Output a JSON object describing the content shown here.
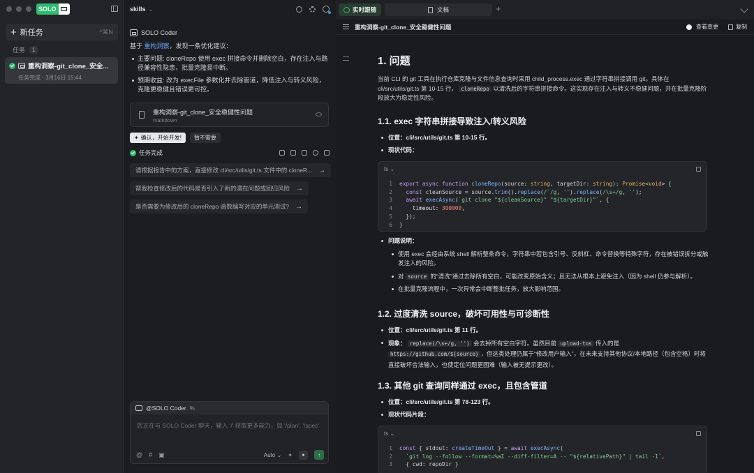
{
  "sidebar": {
    "logo_text": "SOLO",
    "new_task": "新任务",
    "new_task_shortcut": "^⌘N",
    "task_header": "任务",
    "task_count": "1",
    "task_title": "重构洞察-git_clone_安全...",
    "task_meta": "任务完成 · 3月16日 15:44"
  },
  "chat": {
    "workspace": "skills",
    "agent": "SOLO Coder",
    "intro_pre": "基于",
    "intro_link": "重构洞察",
    "intro_post": "，发现一条优化建议：",
    "bullet1": "主要问题: cloneRepo 使用 exec 拼接命令并删除空白，存在注入与路径兼容性隐患，批量克隆易中断。",
    "bullet2": "预期收益: 改为 execFile 参数化并去除管道，降低注入与转义风险，克隆更稳健且错误更可控。",
    "doc_card_title": "重构洞察-git_clone_安全稳健性问题",
    "doc_card_type": "markdown",
    "confirm_btn": "确认，开始开发!",
    "decline_btn": "暂不需要",
    "status": "任务完成",
    "suggestions": [
      "请根据报告中的方案，直接修改 cli/src/utils/git.ts 文件中的 cloneR...",
      "帮我检查修改后的代码是否引入了新的潜在问题或回归风险",
      "是否需要为修改后的 cloneRepo 函数编写对应的单元测试?"
    ],
    "composer_agent": "@SOLO Coder",
    "composer_pct": "%",
    "composer_placeholder": "您正在与 SOLO Coder 聊天，输入 '/' 获取更多能力，如 '/plan', '/spec'",
    "mode": "Auto"
  },
  "panel": {
    "tab_live": "实时跟随",
    "tab_doc": "文档",
    "doc_title": "重构洞察-git_clone_安全稳健性问题",
    "view_changes": "查看变更",
    "copy": "复制"
  },
  "doc": {
    "h1": "1. 问题",
    "intro": "当前 CLI 的 git 工具在执行仓库克隆与文件信息查询时采用 child_process.exec 通过字符串拼接调用 git。具体在 cli/src/utils/git.ts 第 10-15 行，",
    "intro_code": "cloneRepo",
    "intro_tail": "以清洗后的字符串拼接命令。这实现存在注入与转义不稳健问题，并在批量克隆阶段放大为稳定性风险。",
    "s1_title": "1.1. exec 字符串拼接导致注入/转义风险",
    "s1_loc": "位置：cli/src/utils/git.ts 第 10-15 行。",
    "s1_code_label": "现状代码：",
    "lang": "ts",
    "issue_label": "问题说明：",
    "issue1": "使用 exec 会经由系统 shell 解析整条命令，字符串中若包含引号、反斜杠、命令替换等特殊字符，存在被错误拆分或触发注入的风险。",
    "issue2_pre": "对",
    "issue2_code": "source",
    "issue2_post": "的“清洗”通过去除所有空白，可能改变原始含义；且无法从根本上避免注入（因为 shell 仍参与解析）。",
    "issue3": "在批量克隆流程中，一次异常会中断整批任务，放大影响范围。",
    "s2_title": "1.2. 过度清洗 source，破坏可用性与可诊断性",
    "s2_loc": "位置：cli/src/utils/git.ts 第 11 行。",
    "s2_phen_pre": "现象：",
    "s2_code1": "replace(/\\s+/g, '')",
    "s2_phen_mid": "会去掉所有空白字符。虽然目前",
    "s2_code2": "upload-tos",
    "s2_phen_mid2": "传入的是",
    "s2_code3": "https://github.com/${source}",
    "s2_phen_tail": "，但这类处理仍属于“修改用户输入”，在未来支持其他协议/本地路径（包含空格）时将直接破坏合法输入，也使定位问题更困难（输入被无提示更改）。",
    "s3_title": "1.3. 其他 git 查询同样通过 exec，且包含管道",
    "s3_loc": "位置：cli/src/utils/git.ts 第 78-123 行。",
    "s3_code_label": "现状代码片段："
  }
}
